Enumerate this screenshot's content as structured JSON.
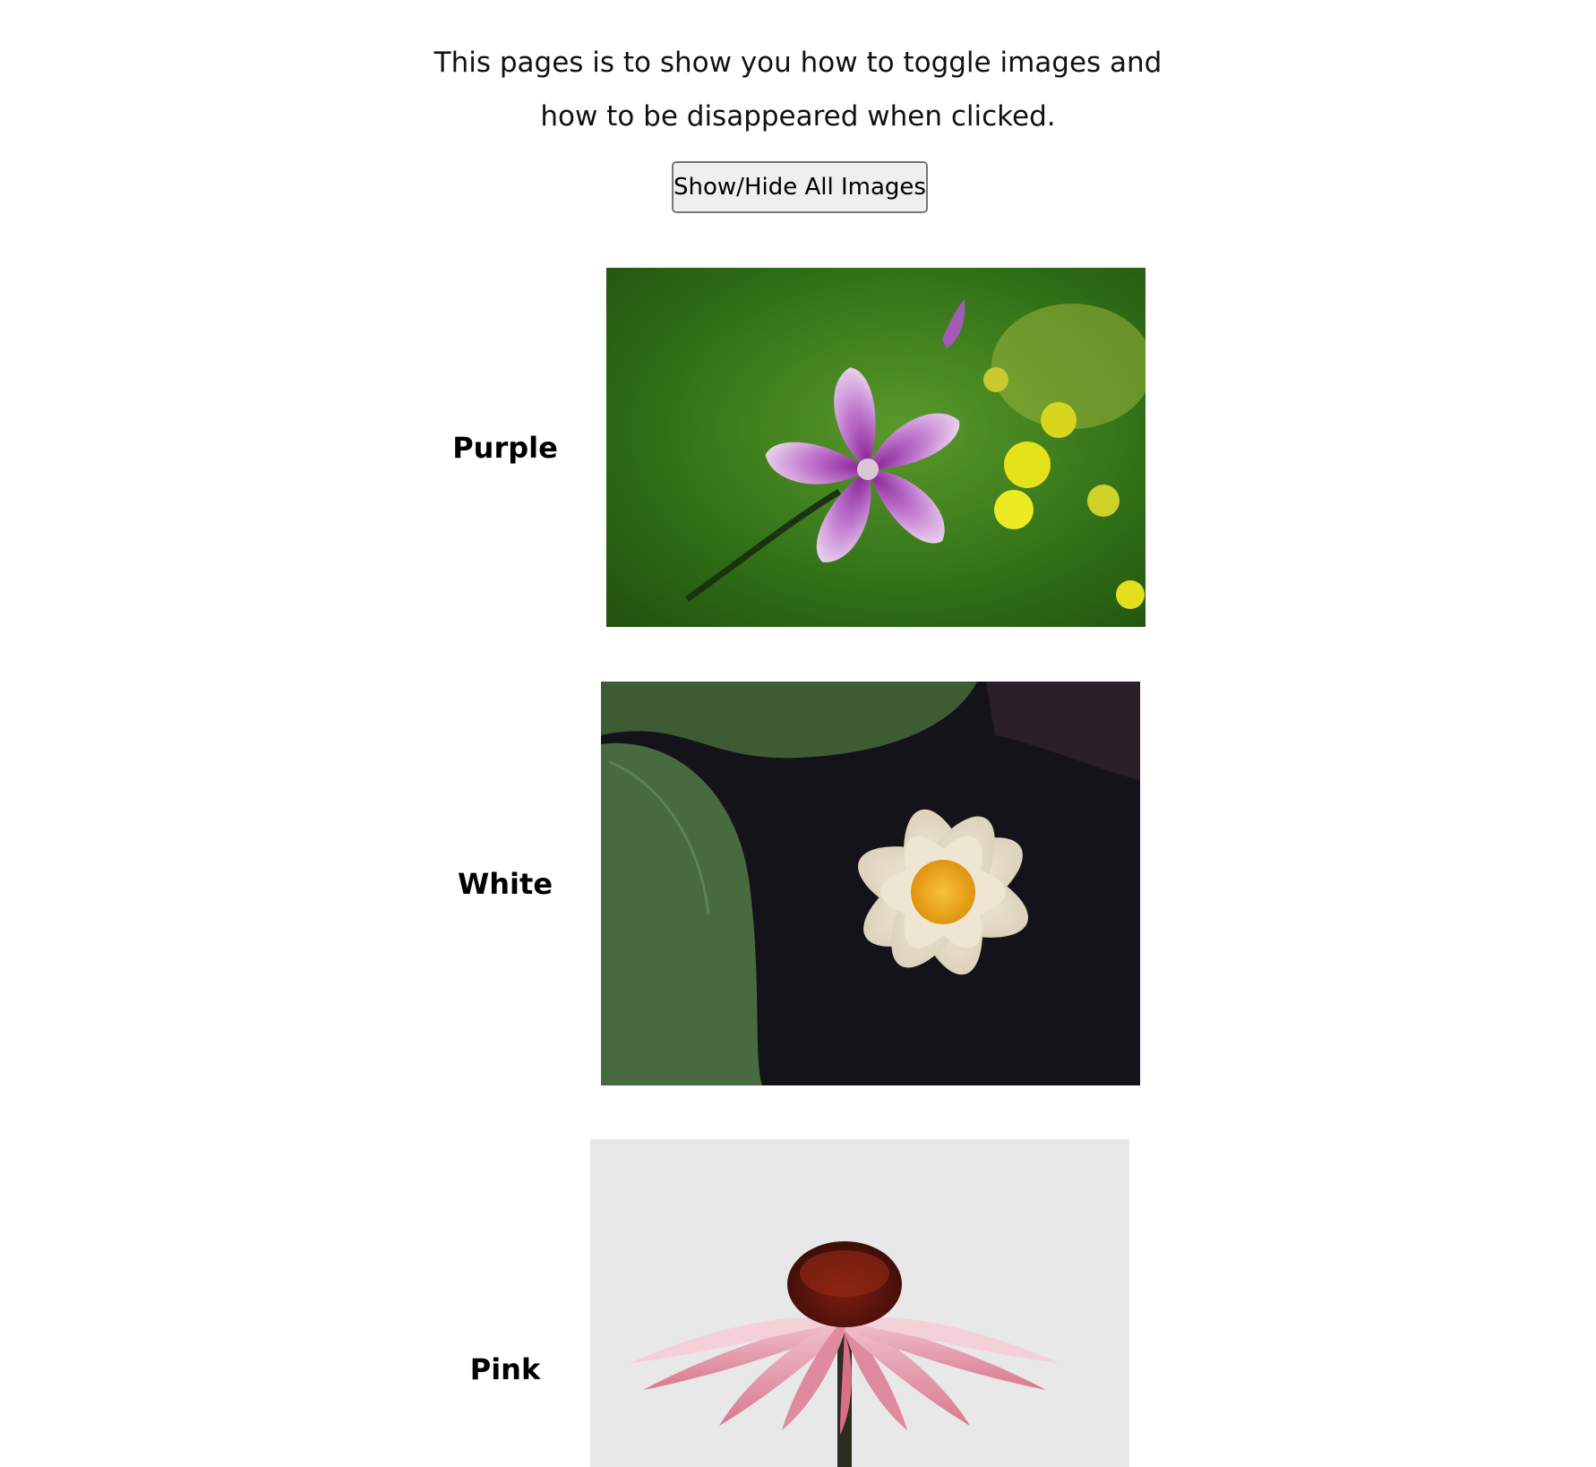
{
  "intro": {
    "line1": "This pages is to show you how to toggle images and",
    "line2": "how to be disappeared when clicked."
  },
  "toolbar": {
    "toggle_label": "Show/Hide All Images"
  },
  "flowers": [
    {
      "label": "Purple",
      "image_icon": "purple-mallow-flower-photo"
    },
    {
      "label": "White",
      "image_icon": "white-water-lily-photo"
    },
    {
      "label": "Pink",
      "image_icon": "pink-coneflower-photo"
    }
  ],
  "colors": {
    "background": "#ffffff",
    "button_bg": "#efefef",
    "button_border": "#767676"
  }
}
